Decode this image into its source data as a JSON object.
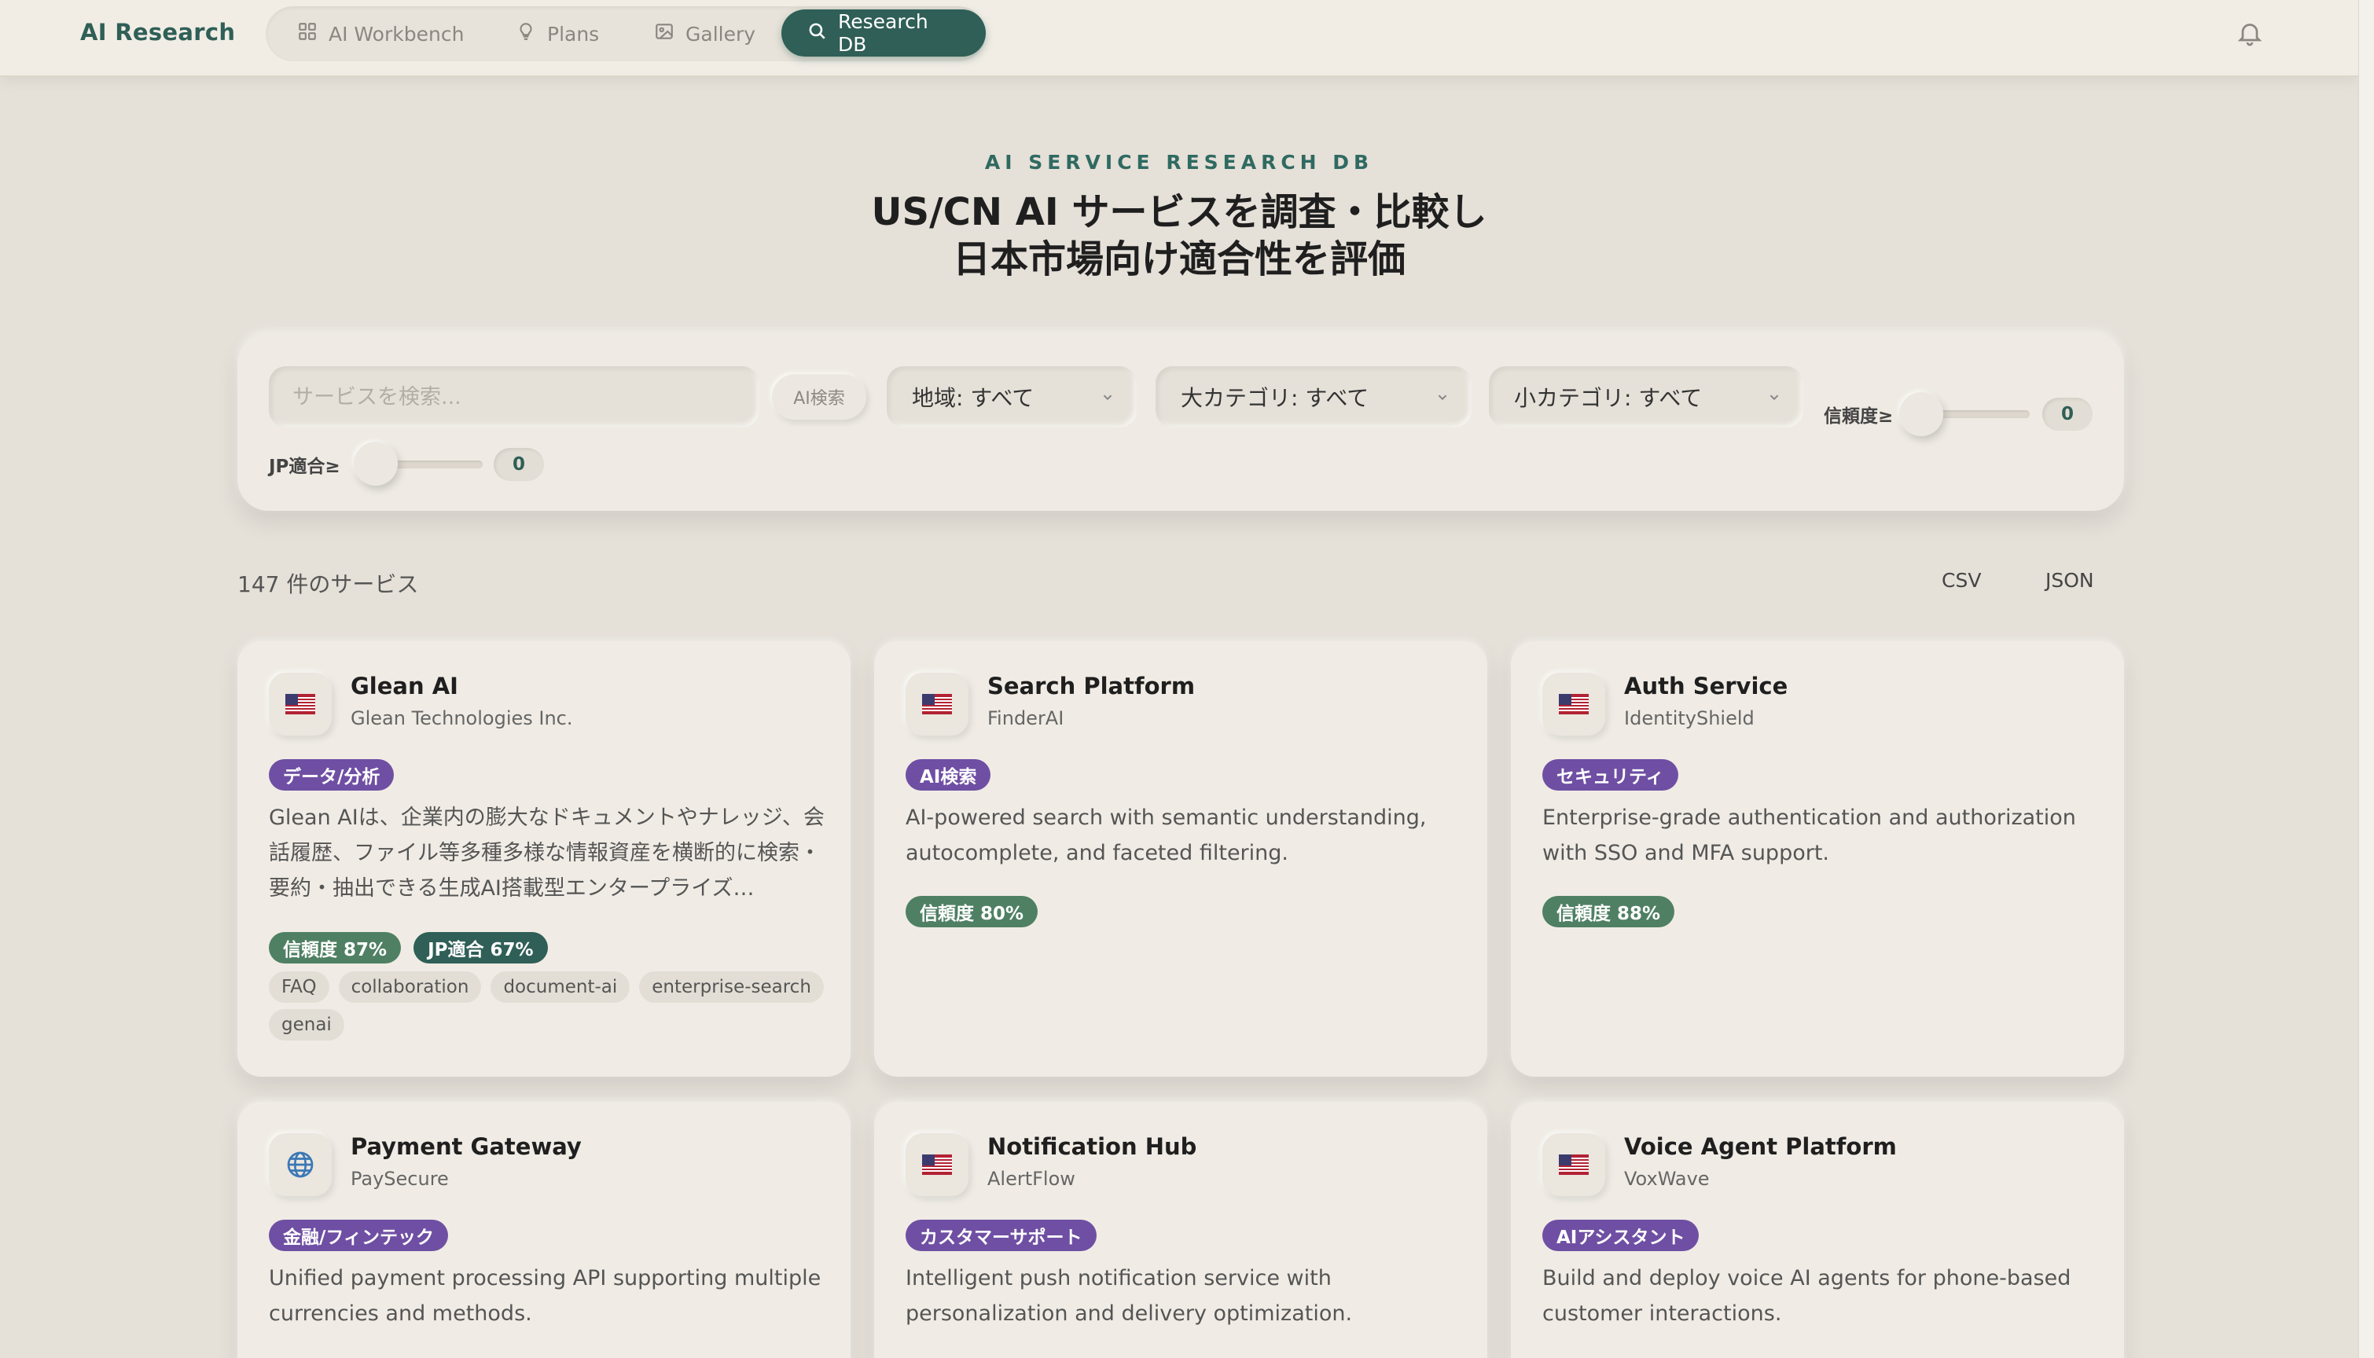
{
  "nav": {
    "brand": "AI Research",
    "items": [
      {
        "label": "AI Workbench",
        "icon": "grid-icon"
      },
      {
        "label": "Plans",
        "icon": "lightbulb-icon"
      },
      {
        "label": "Gallery",
        "icon": "image-icon"
      },
      {
        "label": "Research DB",
        "icon": "search-icon",
        "active": true
      }
    ]
  },
  "hero": {
    "eyebrow": "AI SERVICE RESEARCH DB",
    "title_line1": "US/CN AI サービスを調査・比較し",
    "title_line2": "日本市場向け適合性を評価"
  },
  "filters": {
    "search_placeholder": "サービスを検索...",
    "ai_search_label": "AI検索",
    "region": "地域: すべて",
    "major_category": "大カテゴリ: すべて",
    "minor_category": "小カテゴリ: すべて",
    "confidence_label": "信頼度≥",
    "confidence_value": "0",
    "jp_fit_label": "JP適合≥",
    "jp_fit_value": "0"
  },
  "results": {
    "count_text": "147 件のサービス",
    "export_csv": "CSV",
    "export_json": "JSON"
  },
  "cards": [
    {
      "flag": "us-flag-icon",
      "name": "Glean AI",
      "company": "Glean Technologies Inc.",
      "category": "データ/分析",
      "description": "Glean AIは、企業内の膨大なドキュメントやナレッジ、会話履歴、ファイル等多種多様な情報資産を横断的に検索・要約・抽出できる生成AI搭載型エンタープライズ…",
      "confidence": "信頼度 87%",
      "jp_fit": "JP適合 67%",
      "keywords": [
        "FAQ",
        "collaboration",
        "document-ai",
        "enterprise-search",
        "genai"
      ]
    },
    {
      "flag": "us-flag-icon",
      "name": "Search Platform",
      "company": "FinderAI",
      "category": "AI検索",
      "description": "AI-powered search with semantic understanding, autocomplete, and faceted filtering.",
      "confidence": "信頼度 80%"
    },
    {
      "flag": "us-flag-icon",
      "name": "Auth Service",
      "company": "IdentityShield",
      "category": "セキュリティ",
      "description": "Enterprise-grade authentication and authorization with SSO and MFA support.",
      "confidence": "信頼度 88%"
    },
    {
      "flag": "globe-icon",
      "name": "Payment Gateway",
      "company": "PaySecure",
      "category": "金融/フィンテック",
      "description": "Unified payment processing API supporting multiple currencies and methods."
    },
    {
      "flag": "us-flag-icon",
      "name": "Notification Hub",
      "company": "AlertFlow",
      "category": "カスタマーサポート",
      "description": "Intelligent push notification service with personalization and delivery optimization."
    },
    {
      "flag": "us-flag-icon",
      "name": "Voice Agent Platform",
      "company": "VoxWave",
      "category": "AIアシスタント",
      "description": "Build and deploy voice AI agents for phone-based customer interactions."
    }
  ],
  "colors": {
    "accent": "#2f5f57",
    "category_tag": "#6f4fa3",
    "confidence_badge": "#4f8063",
    "background": "#e5e0d8"
  }
}
